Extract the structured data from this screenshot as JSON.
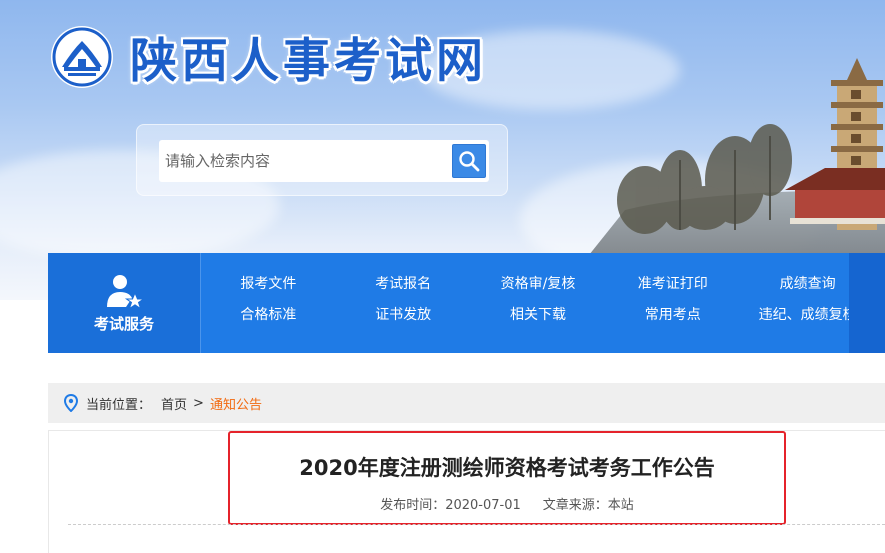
{
  "site": {
    "title": "陕西人事考试网",
    "logo_icon": "site-logo-emblem",
    "brand_color": "#1c5fc9"
  },
  "search": {
    "placeholder": "请输入检索内容",
    "value": "",
    "button_icon": "search-icon"
  },
  "nav": {
    "service_label": "考试服务",
    "service_icon": "user-star-icon",
    "bg_color": "#1f7be6",
    "links": [
      "报考文件",
      "考试报名",
      "资格审/复核",
      "准考证打印",
      "成绩查询",
      "合格标准",
      "证书发放",
      "相关下载",
      "常用考点",
      "违纪、成绩复核"
    ]
  },
  "breadcrumb": {
    "icon": "location-pin-icon",
    "label": "当前位置：",
    "home": "首页",
    "separator": ">",
    "current": "通知公告",
    "current_color": "#f26a10"
  },
  "article": {
    "title": "2020年度注册测绘师资格考试考务工作公告",
    "publish_label": "发布时间：",
    "publish_date": "2020-07-01",
    "source_label": "文章来源：",
    "source": "本站",
    "highlight_color": "#e5232b"
  }
}
